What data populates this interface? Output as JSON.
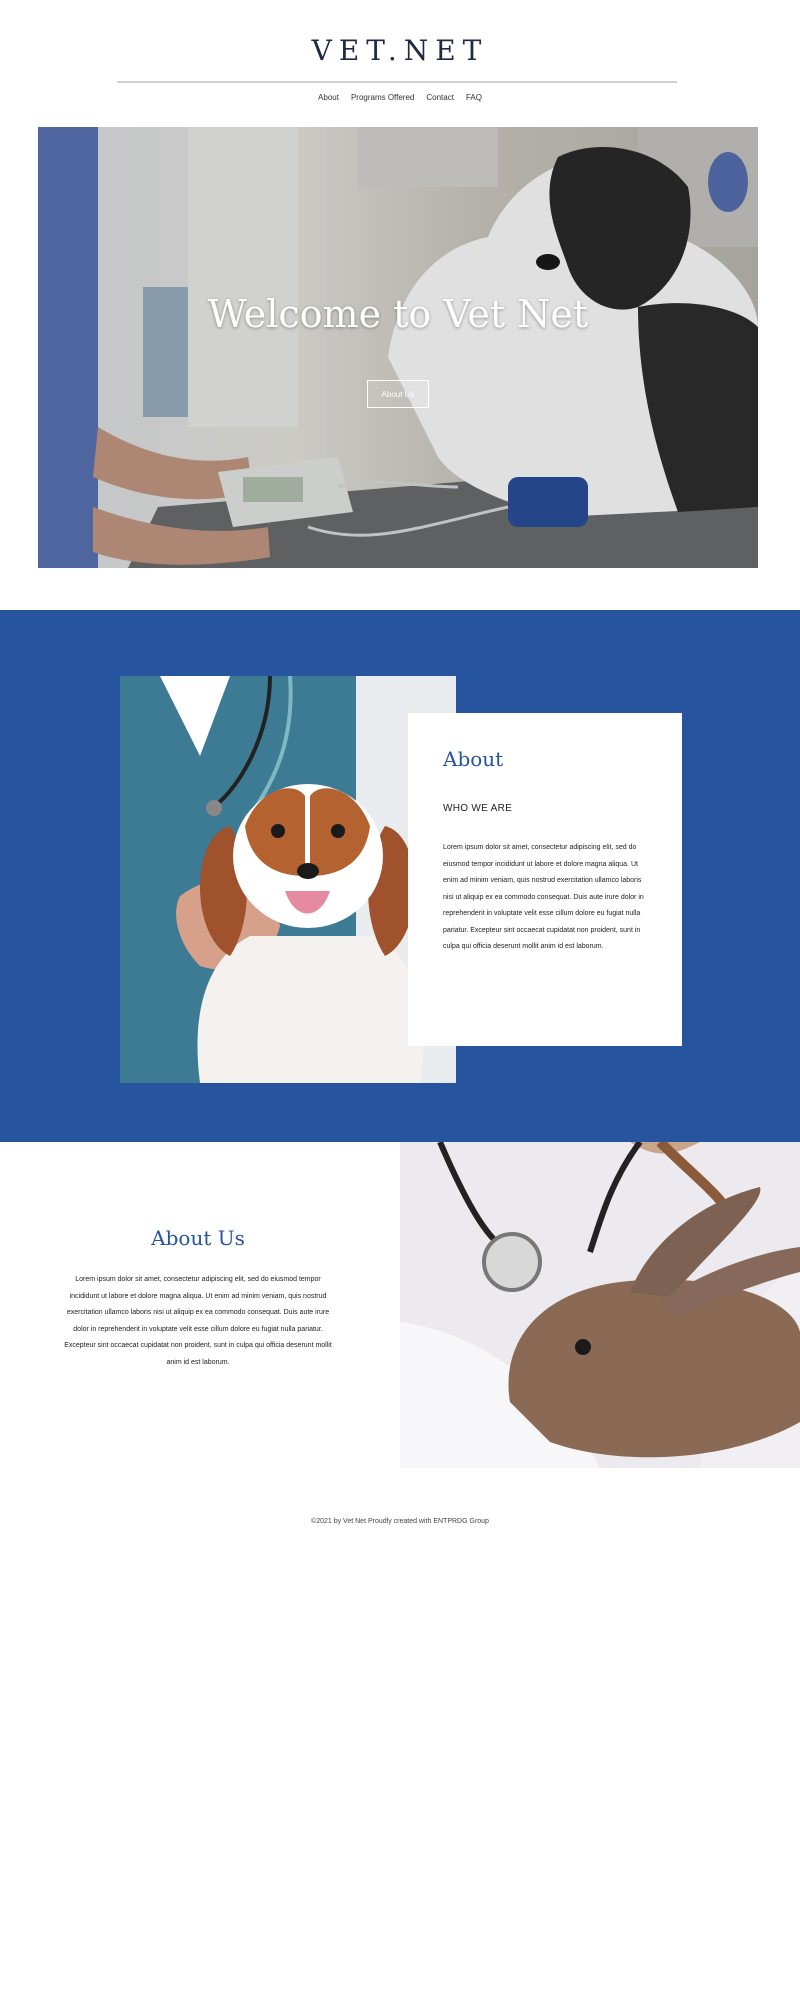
{
  "brand": "VET.NET",
  "nav": [
    "About",
    "Programs Offered",
    "Contact",
    "FAQ"
  ],
  "hero": {
    "title": "Welcome to Vet Net",
    "button": "About Us"
  },
  "about": {
    "title": "About",
    "subtitle": "WHO WE ARE",
    "body": "Lorem ipsum dolor sit amet, consectetur adipiscing elit, sed do eiusmod tempor incididunt ut labore et dolore magna aliqua. Ut enim ad minim veniam, quis nostrud exercitation ullamco laboris nisi ut aliquip ex ea commodo consequat. Duis aute irure dolor in reprehenderit in voluptate velit esse cillum dolore eu fugiat nulla pariatur. Excepteur sint occaecat cupidatat non proident, sunt in culpa qui officia deserunt mollit anim id est laborum."
  },
  "about_us": {
    "title": "About Us",
    "body": "Lorem ipsum dolor sit amet, consectetur adipiscing elit, sed do eiusmod tempor incididunt ut labore et dolore magna aliqua. Ut enim ad minim veniam, quis nostrud exercitation ullamco laboris nisi ut aliquip ex ea commodo consequat. Duis aute irure dolor in reprehenderit in voluptate velit esse cillum dolore eu fugiat nulla pariatur. Excepteur sint occaecat cupidatat non proident, sunt in culpa qui officia deserunt mollit anim id est laborum."
  },
  "footer": "©2021 by Vet Net Proudly created with ENTPRDG Group",
  "colors": {
    "accent": "#27549e",
    "heading": "#1f2a44",
    "background": "#ffffff"
  }
}
